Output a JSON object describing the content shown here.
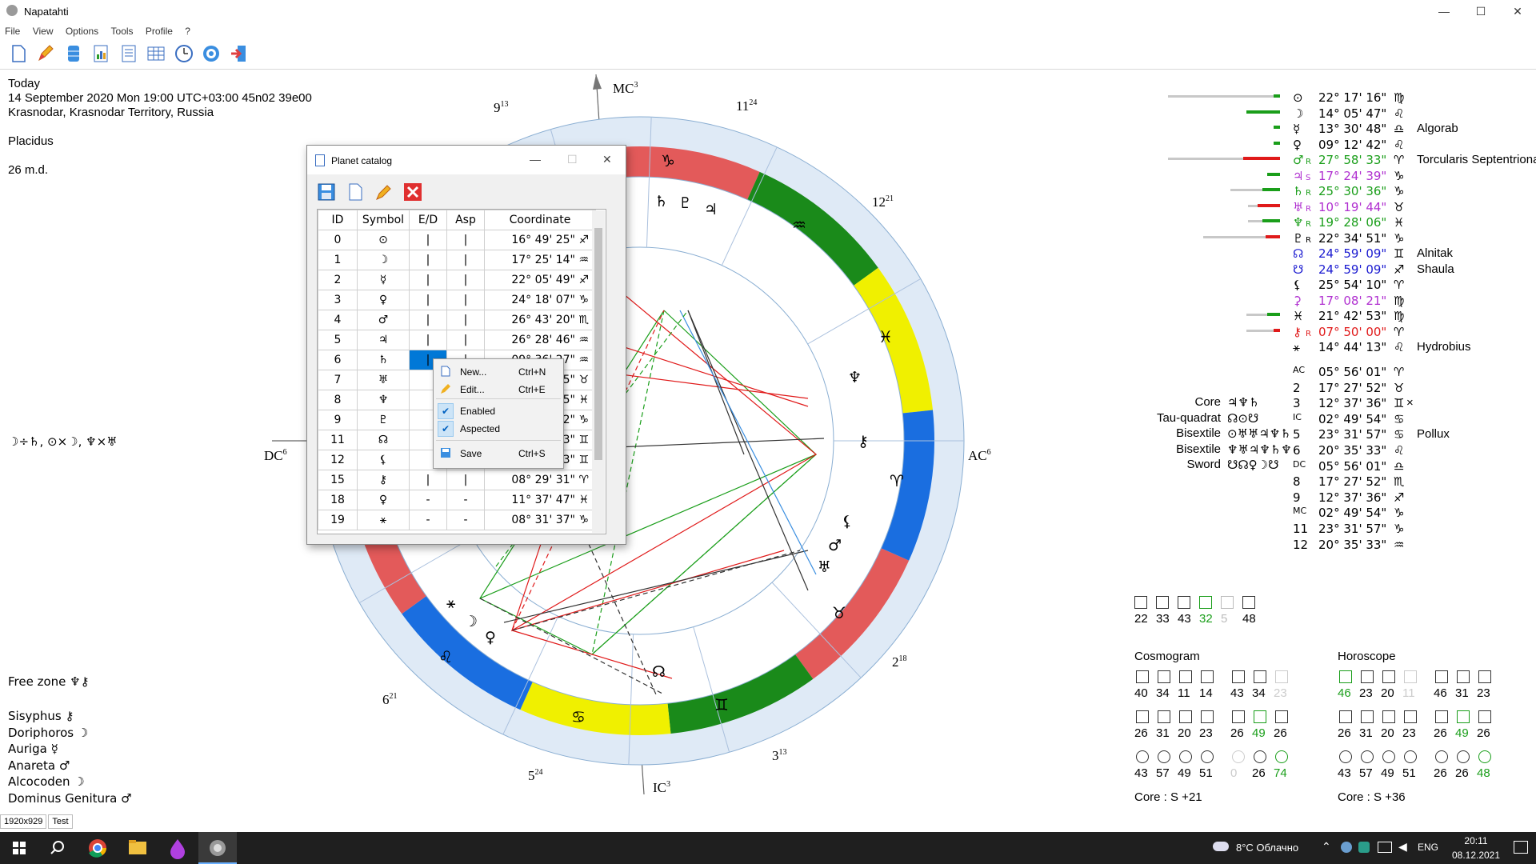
{
  "window": {
    "title": "Napatahti"
  },
  "menu": [
    "File",
    "View",
    "Options",
    "Tools",
    "Profile",
    "?"
  ],
  "info": {
    "today": "Today",
    "datetime": "14 September 2020 Mon 19:00 UTC+03:00 45n02 39e00",
    "place": "Krasnodar, Krasnodar Territory, Russia",
    "house_system": "Placidus",
    "md": "26 m.d.",
    "aspect_note": "☽÷♄, ⊙×☽, ♆×♅",
    "free_zone": "Free zone ♆⚷",
    "sisyphus": "Sisyphus ⚷",
    "doriphoros": "Doriphoros ☽",
    "auriga": "Auriga ☿",
    "anareta": "Anareta ♂",
    "alcocoden": "Alcocoden ☽",
    "dominus": "Dominus Genitura ♂"
  },
  "chart_labels": {
    "mc": "MC",
    "mc_sup": "3",
    "ic": "IC",
    "ic_sup": "3",
    "ac": "AC",
    "ac_sup": "6",
    "dc": "DC",
    "dc_sup": "6",
    "h9": "9",
    "h9s": "13",
    "h11": "11",
    "h11s": "24",
    "h12": "12",
    "h12s": "21",
    "h2": "2",
    "h2s": "18",
    "h3": "3",
    "h3s": "13",
    "h5": "5",
    "h5s": "24",
    "h6": "6",
    "h6s": "21"
  },
  "planets_right": [
    {
      "sym": "⊙",
      "r": "",
      "pos": "22° 17' 16\"",
      "sign": "♍",
      "star": "",
      "color": "#000000"
    },
    {
      "sym": "☽",
      "r": "",
      "pos": "14° 05' 47\"",
      "sign": "♌",
      "star": "",
      "color": "#000000"
    },
    {
      "sym": "☿",
      "r": "",
      "pos": "13° 30' 48\"",
      "sign": "♎",
      "star": "Algorab",
      "color": "#000000"
    },
    {
      "sym": "♀",
      "r": "",
      "pos": "09° 12' 42\"",
      "sign": "♌",
      "star": "",
      "color": "#000000"
    },
    {
      "sym": "♂",
      "r": "R",
      "pos": "27° 58' 33\"",
      "sign": "♈",
      "star": "Torcularis Septentrionalis",
      "color": "#1a9e1a"
    },
    {
      "sym": "♃",
      "r": "S",
      "pos": "17° 24' 39\"",
      "sign": "♑",
      "star": "",
      "color": "#b030d0"
    },
    {
      "sym": "♄",
      "r": "R",
      "pos": "25° 30' 36\"",
      "sign": "♑",
      "star": "",
      "color": "#1a9e1a"
    },
    {
      "sym": "♅",
      "r": "R",
      "pos": "10° 19' 44\"",
      "sign": "♉",
      "star": "",
      "color": "#b030d0"
    },
    {
      "sym": "♆",
      "r": "R",
      "pos": "19° 28' 06\"",
      "sign": "♓",
      "star": "",
      "color": "#1a9e1a"
    },
    {
      "sym": "♇",
      "r": "R",
      "pos": "22° 34' 51\"",
      "sign": "♑",
      "star": "",
      "color": "#000000"
    },
    {
      "sym": "☊",
      "r": "",
      "pos": "24° 59' 09\"",
      "sign": "♊",
      "star": "Alnitak",
      "color": "#1a1ad0"
    },
    {
      "sym": "☋",
      "r": "",
      "pos": "24° 59' 09\"",
      "sign": "♐",
      "star": "Shaula",
      "color": "#1a1ad0"
    },
    {
      "sym": "⚸",
      "r": "",
      "pos": "25° 54' 10\"",
      "sign": "♈",
      "star": "",
      "color": "#000000"
    },
    {
      "sym": "⚳",
      "r": "",
      "pos": "17° 08' 21\"",
      "sign": "♍",
      "star": "",
      "color": "#b030d0"
    },
    {
      "sym": "♓",
      "r": "",
      "pos": "21° 42' 53\"",
      "sign": "♍",
      "star": "",
      "color": "#000000"
    },
    {
      "sym": "⚷",
      "r": "R",
      "pos": "07° 50' 00\"",
      "sign": "♈",
      "star": "",
      "color": "#e01a1a"
    },
    {
      "sym": "⚹",
      "r": "",
      "pos": "14° 44' 13\"",
      "sign": "♌",
      "star": "Hydrobius",
      "color": "#000000"
    }
  ],
  "houses_right": [
    {
      "label": "AC",
      "pos": "05° 56' 01\"",
      "sign": "♈",
      "extra": ""
    },
    {
      "label": "2",
      "pos": "17° 27' 52\"",
      "sign": "♉",
      "extra": ""
    },
    {
      "label": "3",
      "pos": "12° 37' 36\"",
      "sign": "♊",
      "extra": "×"
    },
    {
      "label": "IC",
      "pos": "02° 49' 54\"",
      "sign": "♋",
      "extra": ""
    },
    {
      "label": "5",
      "pos": "23° 31' 57\"",
      "sign": "♋",
      "extra": "Pollux"
    },
    {
      "label": "6",
      "pos": "20° 35' 33\"",
      "sign": "♌",
      "extra": ""
    },
    {
      "label": "DC",
      "pos": "05° 56' 01\"",
      "sign": "♎",
      "extra": ""
    },
    {
      "label": "8",
      "pos": "17° 27' 52\"",
      "sign": "♏",
      "extra": ""
    },
    {
      "label": "9",
      "pos": "12° 37' 36\"",
      "sign": "♐",
      "extra": ""
    },
    {
      "label": "MC",
      "pos": "02° 49' 54\"",
      "sign": "♑",
      "extra": ""
    },
    {
      "label": "11",
      "pos": "23° 31' 57\"",
      "sign": "♑",
      "extra": ""
    },
    {
      "label": "12",
      "pos": "20° 35' 33\"",
      "sign": "♒",
      "extra": ""
    }
  ],
  "configurations": [
    {
      "name": "Core",
      "syms": "♃♆♄"
    },
    {
      "name": "Tau-quadrat",
      "syms": "☊⊙☋"
    },
    {
      "name": "Bisextile",
      "syms": "⊙♅♅♃♆♄"
    },
    {
      "name": "Bisextile",
      "syms": "♆♅♃♆♄♆"
    },
    {
      "name": "Sword",
      "syms": "☋☊♀☽☋"
    }
  ],
  "aspect_counts": [
    "22",
    "33",
    "43",
    "32",
    "5",
    "48"
  ],
  "cosmogram": {
    "title": "Cosmogram",
    "row1": [
      "40",
      "34",
      "11",
      "14",
      "43",
      "34",
      "23"
    ],
    "row2": [
      "26",
      "31",
      "20",
      "23",
      "26",
      "49",
      "26"
    ],
    "row3": [
      "43",
      "57",
      "49",
      "51",
      "0",
      "26",
      "74"
    ],
    "core": "Core : S +21"
  },
  "horoscope": {
    "title": "Horoscope",
    "row1": [
      "46",
      "23",
      "20",
      "11",
      "46",
      "31",
      "23"
    ],
    "row2": [
      "26",
      "31",
      "20",
      "23",
      "26",
      "49",
      "26"
    ],
    "row3": [
      "43",
      "57",
      "49",
      "51",
      "26",
      "26",
      "48"
    ],
    "core": "Core : S +36"
  },
  "dialog": {
    "title": "Planet catalog",
    "headers": [
      "ID",
      "Symbol",
      "E/D",
      "Asp",
      "Coordinate"
    ],
    "rows": [
      {
        "id": "0",
        "sym": "⊙",
        "ed": "|",
        "asp": "|",
        "coord": "16° 49' 25\" ♐"
      },
      {
        "id": "1",
        "sym": "☽",
        "ed": "|",
        "asp": "|",
        "coord": "17° 25' 14\" ♒"
      },
      {
        "id": "2",
        "sym": "☿",
        "ed": "|",
        "asp": "|",
        "coord": "22° 05' 49\" ♐"
      },
      {
        "id": "3",
        "sym": "♀",
        "ed": "|",
        "asp": "|",
        "coord": "24° 18' 07\" ♑"
      },
      {
        "id": "4",
        "sym": "♂",
        "ed": "|",
        "asp": "|",
        "coord": "26° 43' 20\" ♏"
      },
      {
        "id": "5",
        "sym": "♃",
        "ed": "|",
        "asp": "|",
        "coord": "26° 28' 46\" ♒"
      },
      {
        "id": "6",
        "sym": "♄",
        "ed": "|",
        "asp": "|",
        "coord": "09° 36' 27\" ♒"
      },
      {
        "id": "7",
        "sym": "♅",
        "ed": "",
        "asp": "",
        "coord": "5\" ♉"
      },
      {
        "id": "8",
        "sym": "♆",
        "ed": "",
        "asp": "",
        "coord": "5\" ♓"
      },
      {
        "id": "9",
        "sym": "♇",
        "ed": "",
        "asp": "",
        "coord": "2\" ♑"
      },
      {
        "id": "11",
        "sym": "☊",
        "ed": "",
        "asp": "",
        "coord": "3\" ♊"
      },
      {
        "id": "12",
        "sym": "⚸",
        "ed": "",
        "asp": "",
        "coord": "3\" ♊"
      },
      {
        "id": "15",
        "sym": "⚷",
        "ed": "|",
        "asp": "|",
        "coord": "08° 29' 31\" ♈"
      },
      {
        "id": "18",
        "sym": "♀",
        "ed": "-",
        "asp": "-",
        "coord": "11° 37' 47\" ♓"
      },
      {
        "id": "19",
        "sym": "⚹",
        "ed": "-",
        "asp": "-",
        "coord": "08° 31' 37\" ♑"
      }
    ]
  },
  "context_menu": [
    {
      "label": "New...",
      "shortcut": "Ctrl+N"
    },
    {
      "label": "Edit...",
      "shortcut": "Ctrl+E"
    },
    {
      "label": "Enabled",
      "shortcut": ""
    },
    {
      "label": "Aspected",
      "shortcut": ""
    },
    {
      "label": "Save",
      "shortcut": "Ctrl+S"
    }
  ],
  "status": [
    "1920x929",
    "Test"
  ],
  "taskbar": {
    "weather": "8°C Облачно",
    "lang": "ENG",
    "time": "20:11",
    "date": "08.12.2021"
  }
}
